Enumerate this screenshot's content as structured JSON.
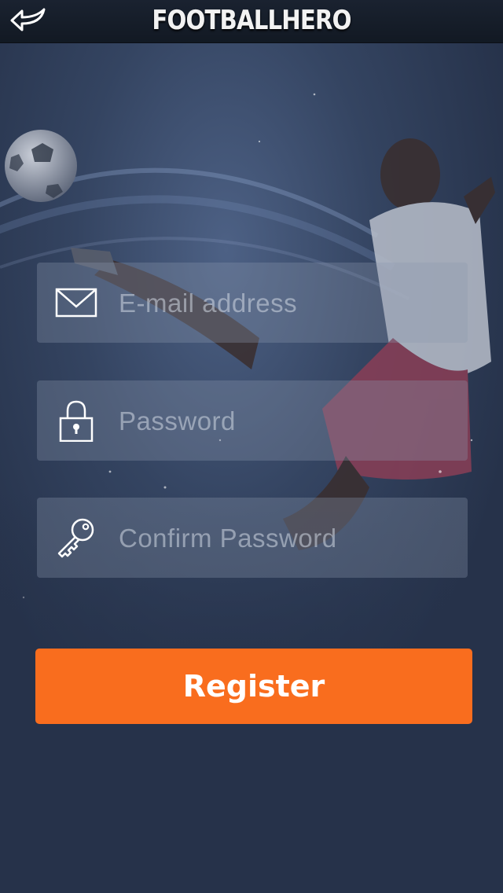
{
  "header": {
    "title": "FOOTBALLHERO",
    "back_icon": "back-arrow-icon"
  },
  "form": {
    "email": {
      "placeholder": "E-mail address",
      "value": "",
      "icon": "envelope-icon"
    },
    "password": {
      "placeholder": "Password",
      "value": "",
      "icon": "lock-icon"
    },
    "confirm_password": {
      "placeholder": "Confirm Password",
      "value": "",
      "icon": "key-icon"
    },
    "register_label": "Register"
  },
  "colors": {
    "accent": "#f96d1e",
    "navbar": "#141b26",
    "background": "#26324a"
  }
}
